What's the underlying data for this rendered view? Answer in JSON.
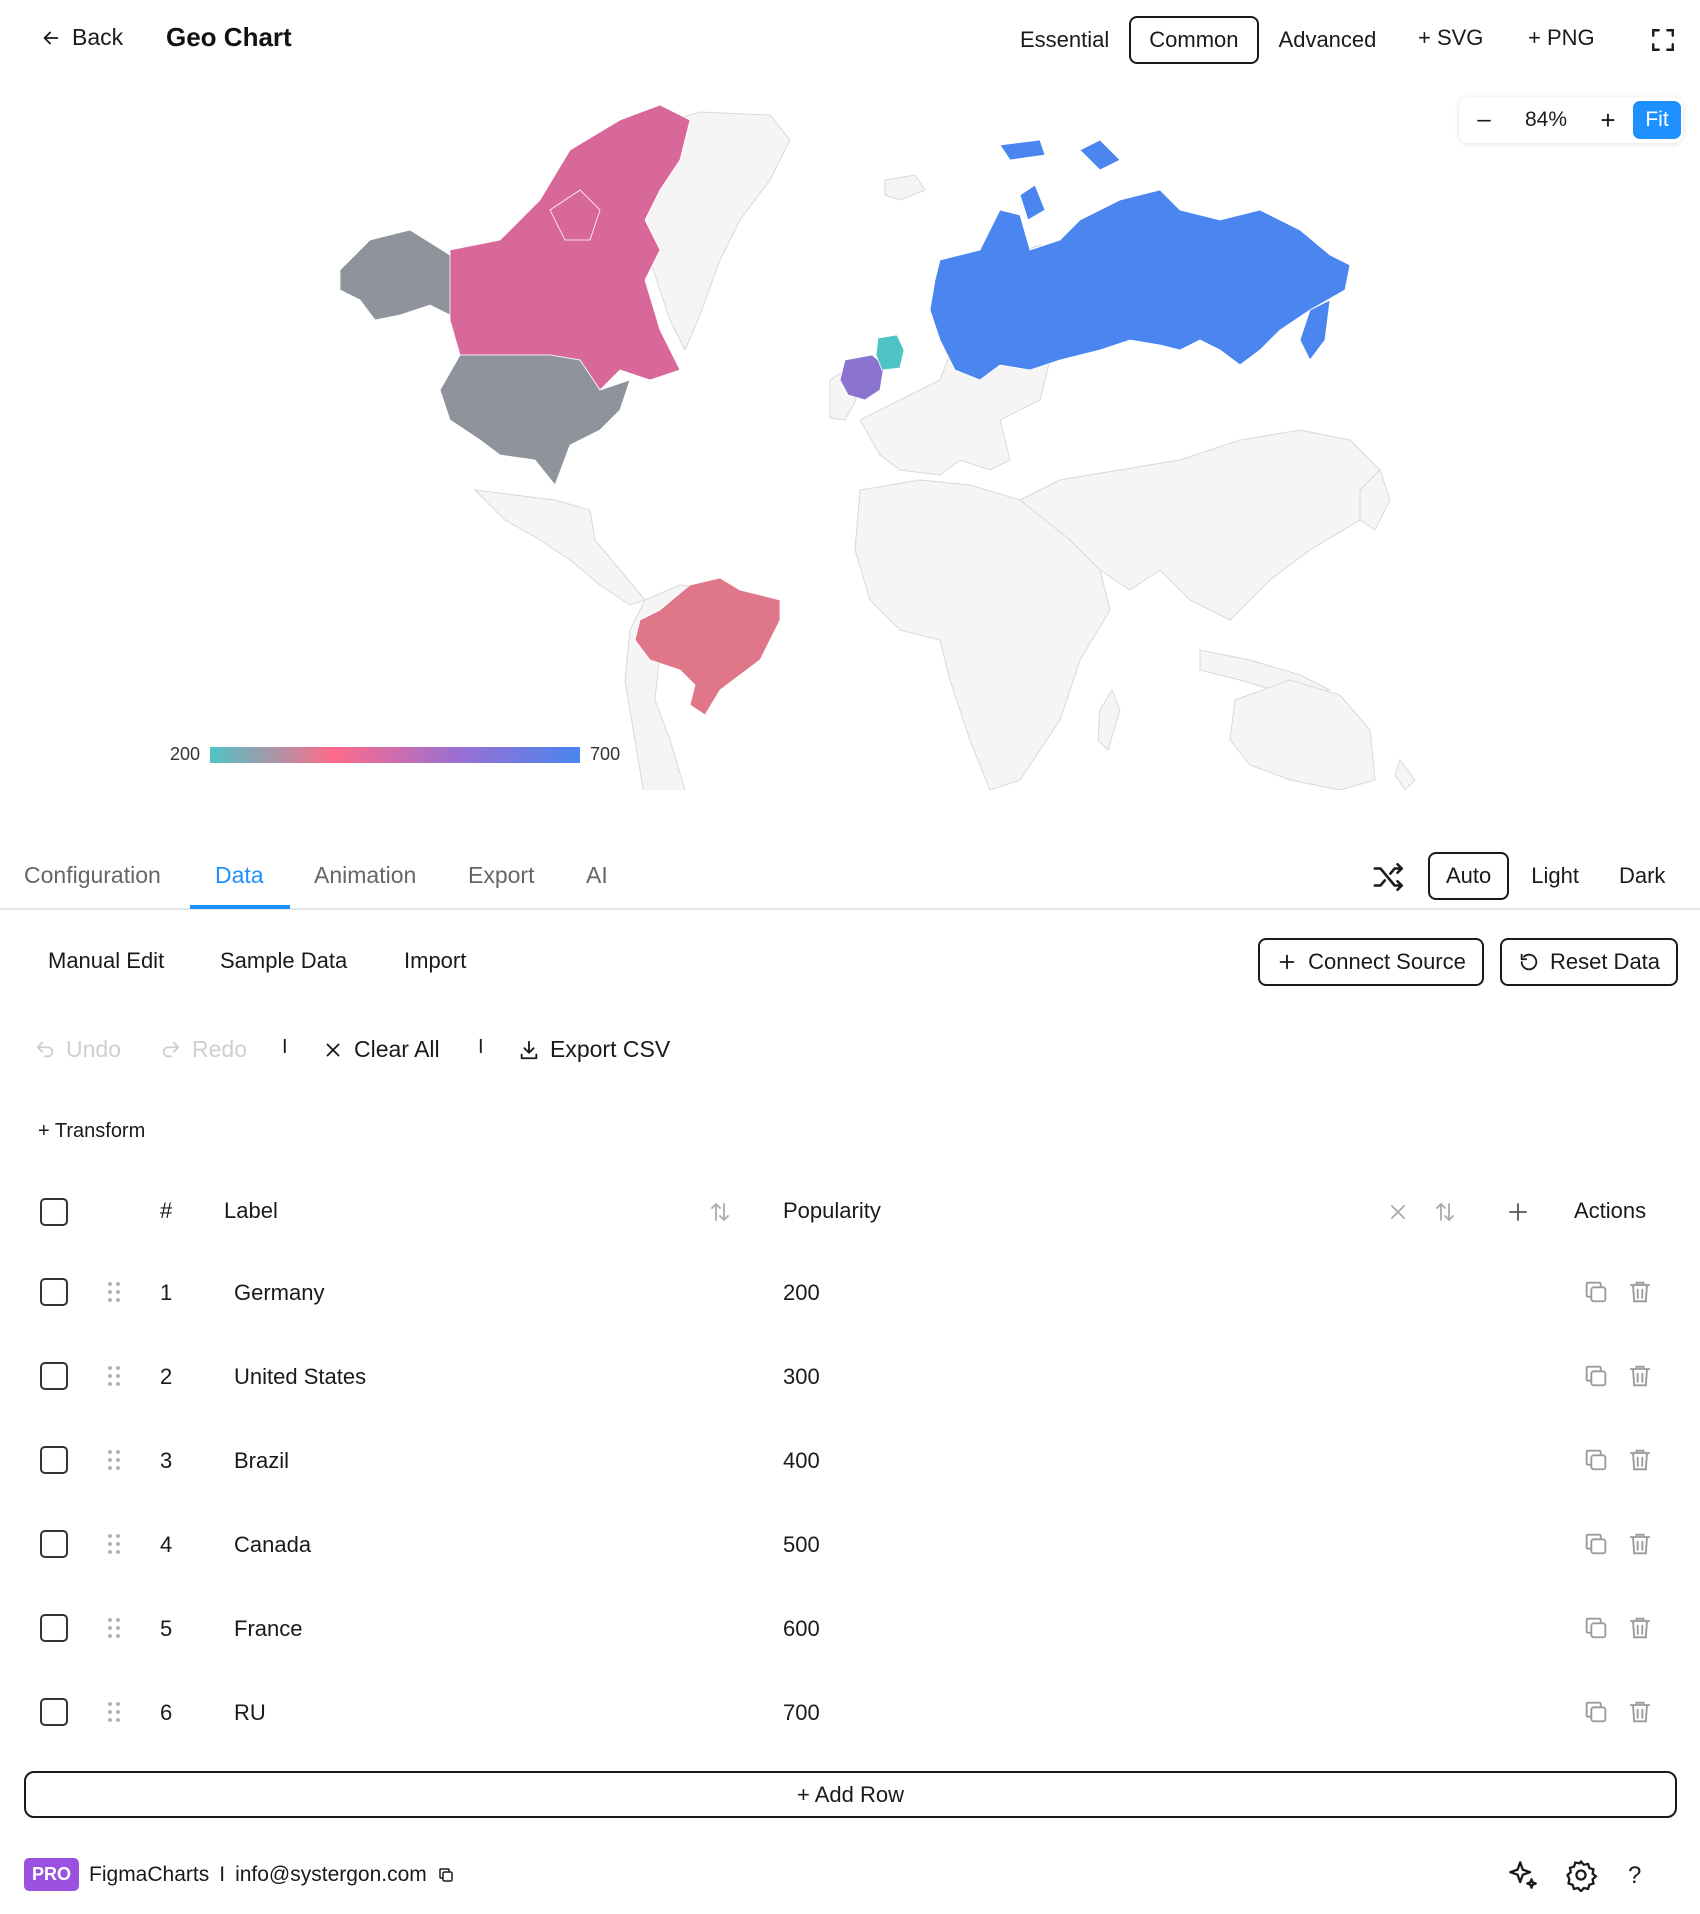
{
  "header": {
    "back_label": "Back",
    "title": "Geo Chart",
    "modes": [
      "Essential",
      "Common",
      "Advanced"
    ],
    "active_mode": "Common",
    "svg_label": "+ SVG",
    "png_label": "+ PNG"
  },
  "zoom": {
    "minus": "–",
    "value": "84%",
    "plus": "+",
    "fit": "Fit"
  },
  "chart_data": {
    "type": "geo-choropleth",
    "regions": [
      {
        "label": "Germany",
        "value": 200
      },
      {
        "label": "United States",
        "value": 300
      },
      {
        "label": "Brazil",
        "value": 400
      },
      {
        "label": "Canada",
        "value": 500
      },
      {
        "label": "France",
        "value": 600
      },
      {
        "label": "RU",
        "value": 700
      }
    ],
    "legend_min": "200",
    "legend_max": "700",
    "colors": {
      "Germany": "#4fc3c5",
      "United States": "#8e939c",
      "Brazil": "#e07789",
      "Canada": "#d9689a",
      "France": "#8b74cf",
      "RU": "#4a85f0",
      "other": "#f5f5f6"
    }
  },
  "tabs": {
    "items": [
      "Configuration",
      "Data",
      "Animation",
      "Export",
      "AI"
    ],
    "active": "Data"
  },
  "theme": {
    "items": [
      "Auto",
      "Light",
      "Dark"
    ],
    "active": "Auto"
  },
  "data_panel": {
    "subtabs": [
      "Manual Edit",
      "Sample Data",
      "Import"
    ],
    "connect_source": "Connect Source",
    "reset_data": "Reset Data",
    "undo": "Undo",
    "redo": "Redo",
    "separator": "I",
    "clear_all": "Clear All",
    "export_csv": "Export CSV",
    "transform": "+ Transform"
  },
  "table": {
    "headers": {
      "num": "#",
      "label": "Label",
      "value": "Popularity",
      "actions": "Actions"
    },
    "rows": [
      {
        "num": "1",
        "label": "Germany",
        "value": "200"
      },
      {
        "num": "2",
        "label": "United States",
        "value": "300"
      },
      {
        "num": "3",
        "label": "Brazil",
        "value": "400"
      },
      {
        "num": "4",
        "label": "Canada",
        "value": "500"
      },
      {
        "num": "5",
        "label": "France",
        "value": "600"
      },
      {
        "num": "6",
        "label": "RU",
        "value": "700"
      }
    ],
    "add_row": "+ Add Row"
  },
  "footer": {
    "badge": "PRO",
    "brand": "FigmaCharts",
    "separator": "I",
    "email": "info@systergon.com",
    "help": "?"
  }
}
